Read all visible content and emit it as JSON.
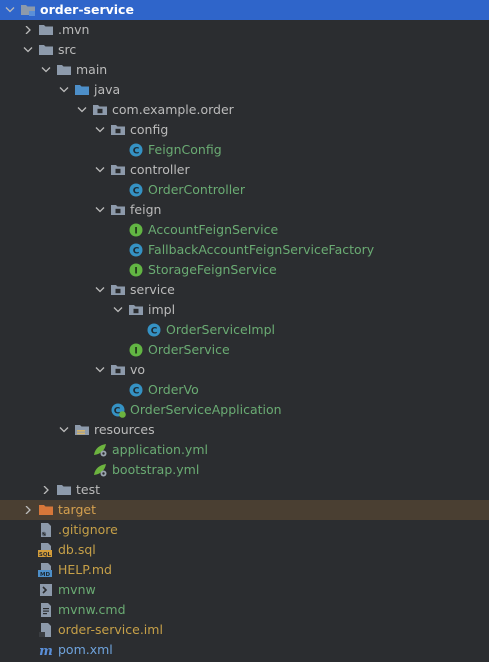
{
  "project_tree": {
    "items": [
      {
        "label": "order-service",
        "depth": 0,
        "arrow": "down",
        "icon": "module-folder-icon",
        "color": "default",
        "selected": true
      },
      {
        "label": ".mvn",
        "depth": 1,
        "arrow": "right",
        "icon": "folder-icon",
        "color": "default"
      },
      {
        "label": "src",
        "depth": 1,
        "arrow": "down",
        "icon": "folder-icon",
        "color": "default"
      },
      {
        "label": "main",
        "depth": 2,
        "arrow": "down",
        "icon": "folder-icon",
        "color": "default"
      },
      {
        "label": "java",
        "depth": 3,
        "arrow": "down",
        "icon": "source-root-folder-icon",
        "color": "default"
      },
      {
        "label": "com.example.order",
        "depth": 4,
        "arrow": "down",
        "icon": "package-icon",
        "color": "default"
      },
      {
        "label": "config",
        "depth": 5,
        "arrow": "down",
        "icon": "package-icon",
        "color": "default"
      },
      {
        "label": "FeignConfig",
        "depth": 6,
        "arrow": "",
        "icon": "class-icon",
        "color": "green"
      },
      {
        "label": "controller",
        "depth": 5,
        "arrow": "down",
        "icon": "package-icon",
        "color": "default"
      },
      {
        "label": "OrderController",
        "depth": 6,
        "arrow": "",
        "icon": "class-icon",
        "color": "green"
      },
      {
        "label": "feign",
        "depth": 5,
        "arrow": "down",
        "icon": "package-icon",
        "color": "default"
      },
      {
        "label": "AccountFeignService",
        "depth": 6,
        "arrow": "",
        "icon": "interface-icon",
        "color": "green"
      },
      {
        "label": "FallbackAccountFeignServiceFactory",
        "depth": 6,
        "arrow": "",
        "icon": "class-icon",
        "color": "green"
      },
      {
        "label": "StorageFeignService",
        "depth": 6,
        "arrow": "",
        "icon": "interface-icon",
        "color": "green"
      },
      {
        "label": "service",
        "depth": 5,
        "arrow": "down",
        "icon": "package-icon",
        "color": "default"
      },
      {
        "label": "impl",
        "depth": 6,
        "arrow": "down",
        "icon": "package-icon",
        "color": "default"
      },
      {
        "label": "OrderServiceImpl",
        "depth": 7,
        "arrow": "",
        "icon": "class-icon",
        "color": "green"
      },
      {
        "label": "OrderService",
        "depth": 6,
        "arrow": "",
        "icon": "interface-icon",
        "color": "green"
      },
      {
        "label": "vo",
        "depth": 5,
        "arrow": "down",
        "icon": "package-icon",
        "color": "default"
      },
      {
        "label": "OrderVo",
        "depth": 6,
        "arrow": "",
        "icon": "class-icon",
        "color": "green"
      },
      {
        "label": "OrderServiceApplication",
        "depth": 5,
        "arrow": "",
        "icon": "spring-boot-class-icon",
        "color": "green"
      },
      {
        "label": "resources",
        "depth": 3,
        "arrow": "down",
        "icon": "resources-folder-icon",
        "color": "default"
      },
      {
        "label": "application.yml",
        "depth": 4,
        "arrow": "",
        "icon": "spring-yaml-icon",
        "color": "green"
      },
      {
        "label": "bootstrap.yml",
        "depth": 4,
        "arrow": "",
        "icon": "spring-yaml-icon",
        "color": "green"
      },
      {
        "label": "test",
        "depth": 2,
        "arrow": "right",
        "icon": "folder-icon",
        "color": "default"
      },
      {
        "label": "target",
        "depth": 1,
        "arrow": "right",
        "icon": "excluded-folder-icon",
        "color": "orange",
        "excluded": true
      },
      {
        "label": ".gitignore",
        "depth": 1,
        "arrow": "",
        "icon": "gitignore-icon",
        "color": "git"
      },
      {
        "label": "db.sql",
        "depth": 1,
        "arrow": "",
        "icon": "sql-file-icon",
        "color": "git"
      },
      {
        "label": "HELP.md",
        "depth": 1,
        "arrow": "",
        "icon": "markdown-file-icon",
        "color": "git"
      },
      {
        "label": "mvnw",
        "depth": 1,
        "arrow": "",
        "icon": "shell-script-icon",
        "color": "green"
      },
      {
        "label": "mvnw.cmd",
        "depth": 1,
        "arrow": "",
        "icon": "text-file-icon",
        "color": "green"
      },
      {
        "label": "order-service.iml",
        "depth": 1,
        "arrow": "",
        "icon": "iml-file-icon",
        "color": "git"
      },
      {
        "label": "pom.xml",
        "depth": 1,
        "arrow": "",
        "icon": "maven-pom-icon",
        "color": "blue"
      }
    ]
  },
  "colors": {
    "background": "#2b2d30",
    "selection": "#2f65ca",
    "excluded_row": "#4a3f32",
    "text_default": "#bbbbbb",
    "text_green": "#6aab73",
    "text_git": "#c6a048",
    "text_orange": "#d5a04f",
    "text_blue": "#6fa3dc"
  }
}
